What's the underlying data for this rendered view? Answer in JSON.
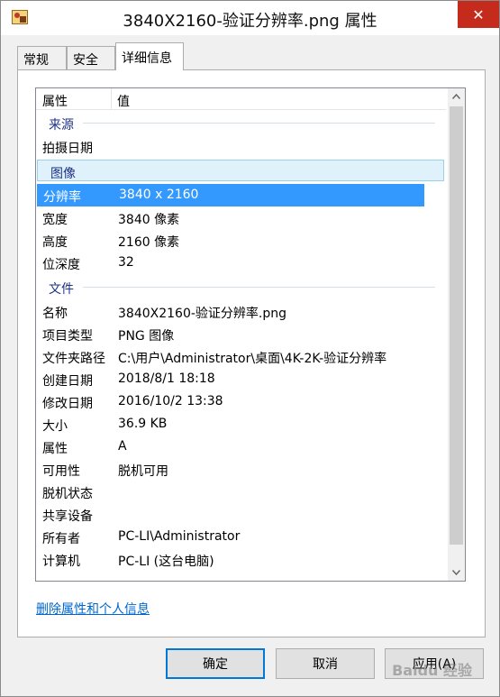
{
  "window": {
    "title": "3840X2160-验证分辨率.png 属性",
    "close_glyph": "✕"
  },
  "tabs": [
    "常规",
    "安全",
    "详细信息"
  ],
  "active_tab": "详细信息",
  "list": {
    "header": {
      "property": "属性",
      "value": "值"
    },
    "groups": {
      "source": "来源",
      "image": "图像",
      "file": "文件"
    },
    "source_rows": [
      {
        "key": "拍摄日期",
        "value": ""
      }
    ],
    "image_rows": [
      {
        "key": "分辨率",
        "value": "3840 x 2160"
      },
      {
        "key": "宽度",
        "value": "3840 像素"
      },
      {
        "key": "高度",
        "value": "2160 像素"
      },
      {
        "key": "位深度",
        "value": "32"
      }
    ],
    "file_rows": [
      {
        "key": "名称",
        "value": "3840X2160-验证分辨率.png"
      },
      {
        "key": "项目类型",
        "value": "PNG 图像"
      },
      {
        "key": "文件夹路径",
        "value": "C:\\用户\\Administrator\\桌面\\4K-2K-验证分辨率"
      },
      {
        "key": "创建日期",
        "value": "2018/8/1 18:18"
      },
      {
        "key": "修改日期",
        "value": "2016/10/2 13:38"
      },
      {
        "key": "大小",
        "value": "36.9 KB"
      },
      {
        "key": "属性",
        "value": "A"
      },
      {
        "key": "可用性",
        "value": "脱机可用"
      },
      {
        "key": "脱机状态",
        "value": ""
      },
      {
        "key": "共享设备",
        "value": ""
      },
      {
        "key": "所有者",
        "value": "PC-LI\\Administrator"
      },
      {
        "key": "计算机",
        "value": "PC-LI (这台电脑)"
      }
    ]
  },
  "remove_link": "删除属性和个人信息",
  "buttons": {
    "ok": "确定",
    "cancel": "取消",
    "apply": "应用(A)"
  },
  "watermark": "Baidu 经验",
  "colors": {
    "selection": "#3399ff",
    "group_selected": "#dff1fa",
    "group_text": "#1e3287",
    "close": "#c42b1c",
    "link": "#0066cc"
  }
}
